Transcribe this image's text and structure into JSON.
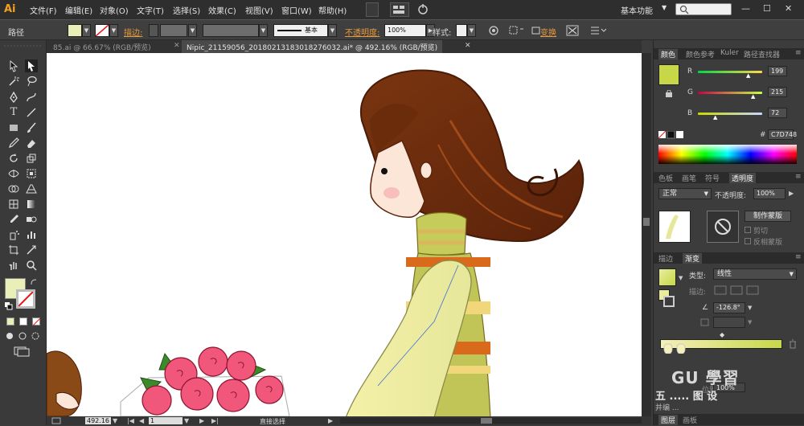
{
  "app": {
    "logo": "Ai"
  },
  "menubar": {
    "items": [
      "文件(F)",
      "编辑(E)",
      "对象(O)",
      "文字(T)",
      "选择(S)",
      "效果(C)",
      "视图(V)",
      "窗口(W)",
      "帮助(H)"
    ],
    "workspace_label": "基本功能",
    "search_placeholder": ""
  },
  "controlbar": {
    "selection_label": "路径",
    "stroke_label": "描边:",
    "stroke_style": "基本",
    "opacity_label": "不透明度:",
    "opacity_value": "100%",
    "style_label": "样式:",
    "transform_label": "变换"
  },
  "tabs": [
    {
      "label": "85.ai @ 66.67% (RGB/预览)",
      "active": false
    },
    {
      "label": "Nipic_21159056_20180213183018276032.ai* @ 492.16% (RGB/预览)",
      "active": true
    }
  ],
  "status": {
    "zoom": "492.16",
    "page": "1",
    "tool": "直接选择"
  },
  "color_panel": {
    "tabs": [
      "颜色",
      "颜色参考",
      "Kuler",
      "路径查找器"
    ],
    "channels": [
      {
        "name": "R",
        "value": "199"
      },
      {
        "name": "G",
        "value": "215"
      },
      {
        "name": "B",
        "value": "72"
      }
    ],
    "hex": "C7D748",
    "swatch_color": "#c7d748"
  },
  "transparency_panel": {
    "tabs": [
      "色板",
      "画笔",
      "符号",
      "透明度"
    ],
    "blend_mode": "正常",
    "opacity_label": "不透明度:",
    "opacity_value": "100%",
    "make_mask_label": "制作蒙版",
    "clip_label": "剪切",
    "invert_label": "反相蒙版"
  },
  "gradient_panel": {
    "tabs": [
      "描边",
      "渐变"
    ],
    "type_label": "类型:",
    "type_value": "线性",
    "stroke_label": "描边:",
    "angle_value": "-126.8°",
    "position_label": "位置:",
    "position_value": "100%"
  },
  "bottom_tabs": [
    "图层",
    "画板"
  ],
  "watermark": {
    "line1": "GU 學習",
    "line2": "五 ..... 图 设",
    "sub": "并编 ..."
  }
}
